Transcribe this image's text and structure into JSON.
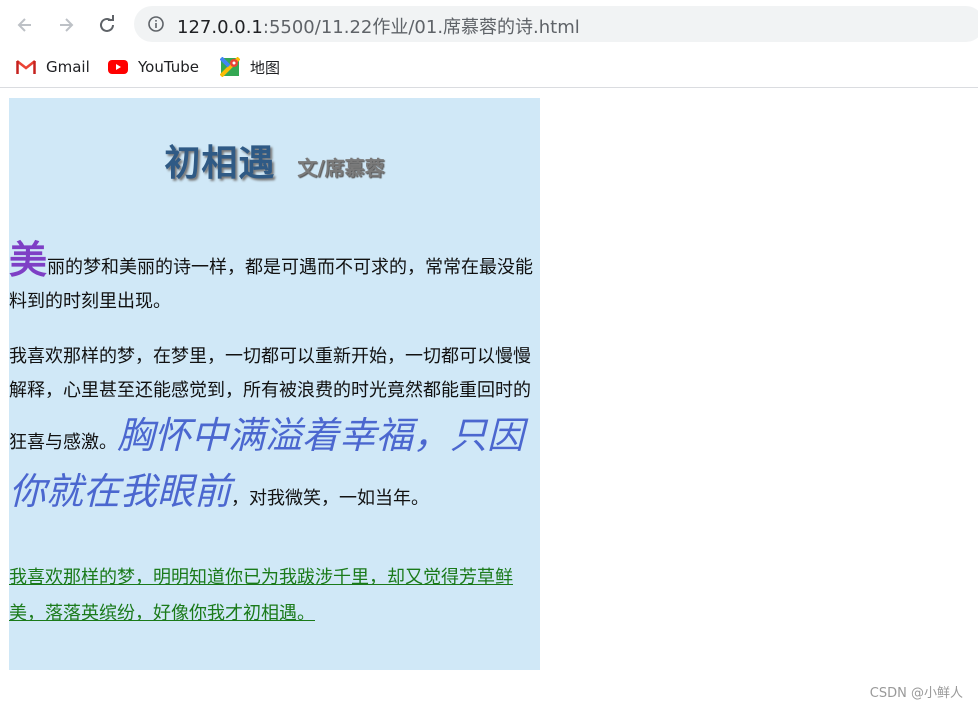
{
  "browser": {
    "url_host": "127.0.0.1",
    "url_rest": ":5500/11.22作业/01.席慕蓉的诗.html",
    "bookmarks": [
      {
        "label": "Gmail",
        "icon": "gmail-icon"
      },
      {
        "label": "YouTube",
        "icon": "youtube-icon"
      },
      {
        "label": "地图",
        "icon": "maps-icon"
      }
    ]
  },
  "page": {
    "title": "初相遇",
    "author": "文/席慕蓉",
    "p1_dropcap": "美",
    "p1_text": "丽的梦和美丽的诗一样，都是可遇而不可求的，常常在最没能料到的时刻里出现。",
    "p2_text": "我喜欢那样的梦，在梦里，一切都可以重新开始，一切都可以慢慢解释，心里甚至还能感觉到，所有被浪费的时光竟然都能重回时的狂喜与感激。",
    "p2_emphasis": "胸怀中满溢着幸福，只因你就在我眼前",
    "p2_tail": "，对我微笑，一如当年。",
    "p3_text": "我喜欢那样的梦，明明知道你已为我跋涉千里，却又觉得芳草鲜美，落落英缤纷，好像你我才初相遇。"
  },
  "watermark": "CSDN @小鲜人",
  "colors": {
    "content_bg": "#d0e8f7",
    "title": "#2f5a85",
    "dropcap": "#7e3fc5",
    "emphasis": "#4b67cf",
    "link_green": "#1a7a1a"
  }
}
